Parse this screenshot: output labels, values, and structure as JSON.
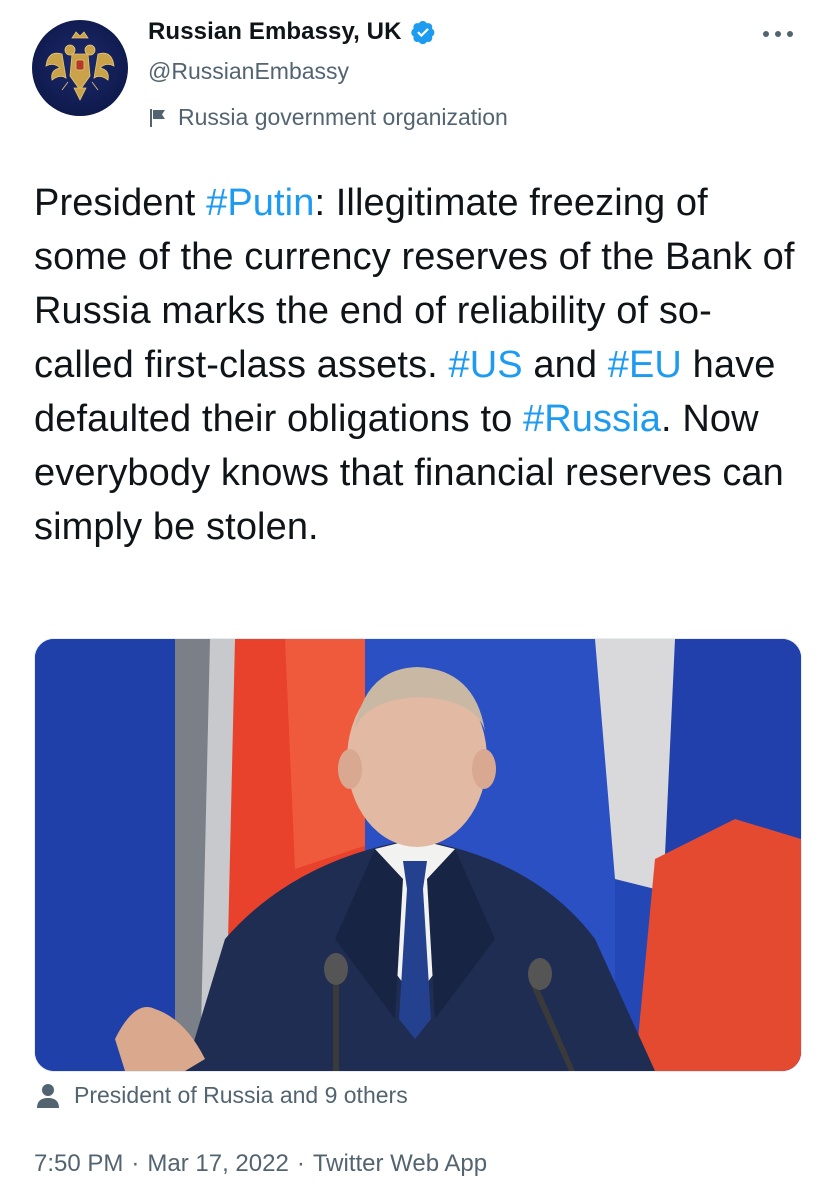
{
  "account": {
    "display_name": "Russian Embassy, UK",
    "handle": "@RussianEmbassy",
    "label": "Russia government organization",
    "verified": true,
    "avatar_icon": "double-headed-eagle-emblem"
  },
  "tweet": {
    "segments": [
      {
        "text": "President ",
        "hashtag": false
      },
      {
        "text": "#Putin",
        "hashtag": true
      },
      {
        "text": ": Illegitimate freezing of some of the currency reserves of the Bank of Russia marks the end of reliability of so-called first-class assets. ",
        "hashtag": false
      },
      {
        "text": "#US",
        "hashtag": true
      },
      {
        "text": " and ",
        "hashtag": false
      },
      {
        "text": "#EU",
        "hashtag": true
      },
      {
        "text": " have defaulted their obligations to ",
        "hashtag": false
      },
      {
        "text": "#Russia",
        "hashtag": true
      },
      {
        "text": ". Now everybody knows that financial reserves can simply be stolen.",
        "hashtag": false
      }
    ]
  },
  "media": {
    "tagged": "President of Russia and 9 others"
  },
  "meta": {
    "time": "7:50 PM",
    "separator1": "·",
    "date": "Mar 17, 2022",
    "separator2": "·",
    "source": "Twitter Web App"
  },
  "colors": {
    "link": "#1d9bf0",
    "secondary_text": "#536471",
    "verified": "#1d9bf0"
  }
}
